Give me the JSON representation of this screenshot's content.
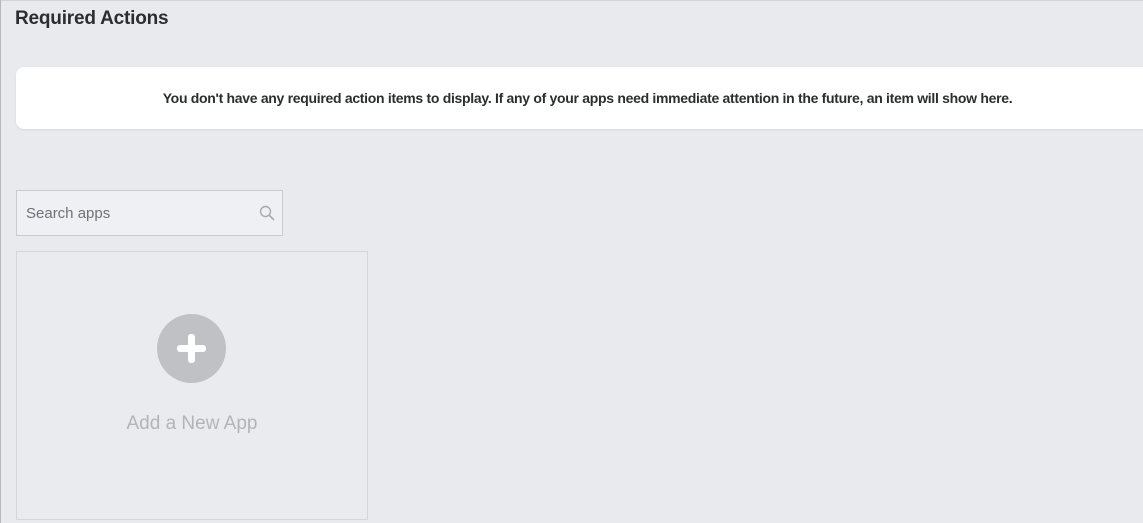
{
  "required_actions": {
    "title": "Required Actions",
    "empty_message": "You don't have any required action items to display. If any of your apps need immediate attention in the future, an item will show here."
  },
  "search": {
    "placeholder": "Search apps",
    "value": "",
    "icon": "search-icon"
  },
  "add_app_tile": {
    "label": "Add a New App",
    "icon": "plus-circle-icon"
  },
  "colors": {
    "page_background": "#e9eaee",
    "card_background": "#ffffff",
    "heading_text": "#2b2d31",
    "muted_text": "#b2b4b8",
    "plus_circle": "#bfc1c5"
  }
}
